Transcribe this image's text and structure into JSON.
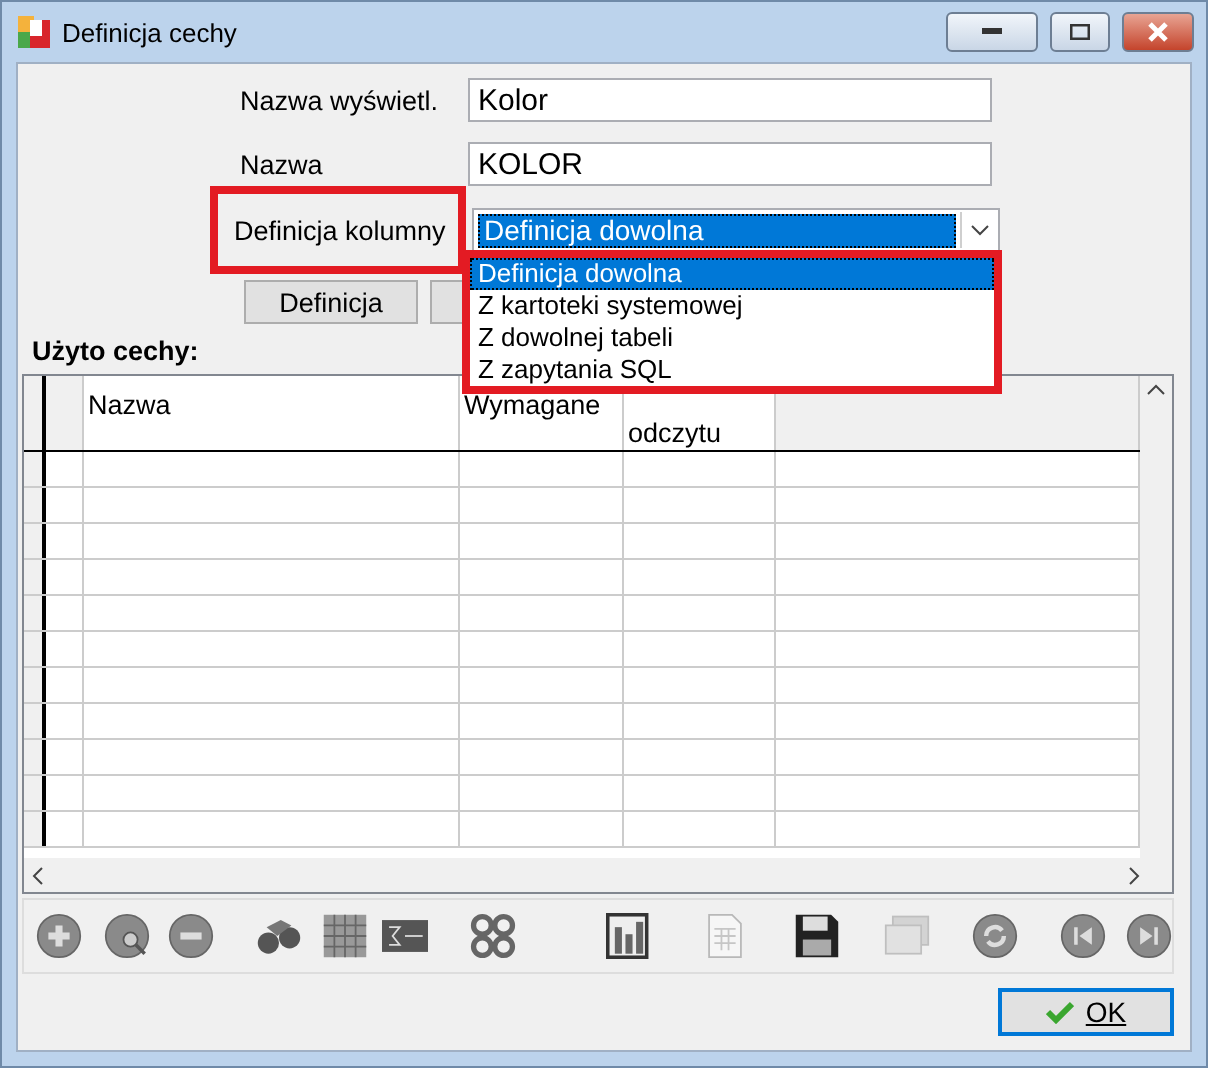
{
  "window": {
    "title": "Definicja cechy"
  },
  "fields": [
    {
      "label": "Nazwa wyświetl.",
      "value": "Kolor"
    },
    {
      "label": "Nazwa",
      "value": "KOLOR"
    }
  ],
  "column_definition": {
    "label": "Definicja kolumny",
    "value": "Definicja dowolna",
    "highlighted": true,
    "expanded": true,
    "options": [
      {
        "label": "Definicja dowolna",
        "selected": true
      },
      {
        "label": "Z kartoteki systemowej",
        "selected": false
      },
      {
        "label": "Z dowolnej tabeli",
        "selected": false
      },
      {
        "label": "Z zapytania SQL",
        "selected": false
      }
    ]
  },
  "buttons": [
    {
      "label": "Definicja"
    }
  ],
  "section_title": "Użyto cechy:",
  "table": {
    "columns": [
      "Nazwa",
      "Wymagane",
      "odczytu"
    ]
  },
  "toolbar": [
    {
      "kind": "plus",
      "disabled": false
    },
    {
      "kind": "find",
      "disabled": false
    },
    {
      "kind": "minus",
      "disabled": false
    },
    {
      "kind": "binoculars",
      "disabled": false
    },
    {
      "kind": "grid",
      "disabled": false
    },
    {
      "kind": "sigma",
      "disabled": false
    },
    {
      "kind": "gears",
      "disabled": false
    },
    {
      "kind": "chart",
      "disabled": false
    },
    {
      "kind": "sheet",
      "disabled": true
    },
    {
      "kind": "floppy",
      "disabled": false
    },
    {
      "kind": "windows",
      "disabled": true
    },
    {
      "kind": "refresh",
      "disabled": false
    },
    {
      "kind": "first",
      "disabled": false
    },
    {
      "kind": "last",
      "disabled": false
    }
  ],
  "ok_button": {
    "label": "OK"
  }
}
